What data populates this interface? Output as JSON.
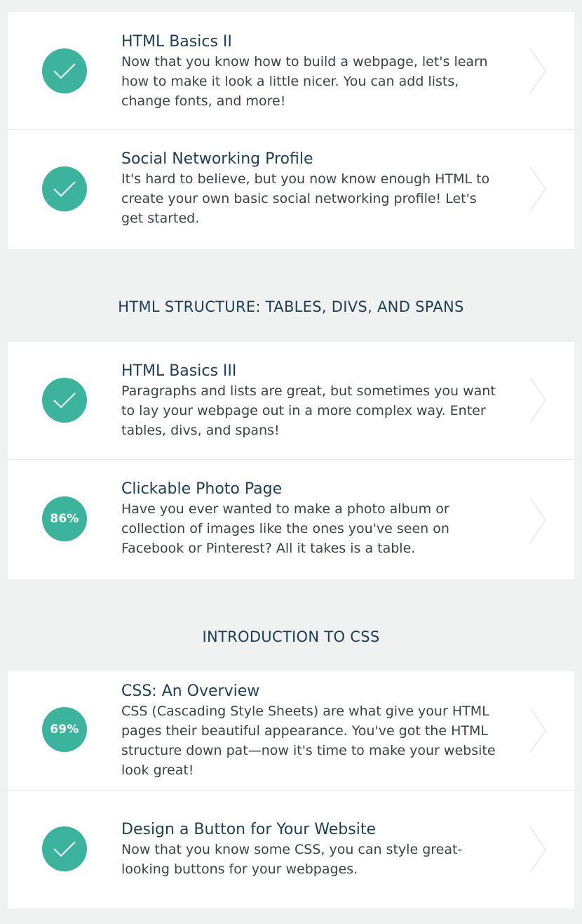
{
  "colors": {
    "accent": "#3cb39d",
    "title": "#1e3d57",
    "body_text": "#3b4248",
    "background": "#f0f2f2",
    "card": "#ffffff"
  },
  "groups": [
    {
      "lessons": [
        {
          "title": "HTML Basics II",
          "description": "Now that you know how to build a webpage, let's learn how to make it look a little nicer. You can add lists, change fonts, and more!",
          "status": "complete",
          "icon": "check-icon"
        },
        {
          "title": "Social Networking Profile",
          "description": "It's hard to believe, but you now know enough HTML to create your own basic social networking profile! Let's get started.",
          "status": "complete",
          "icon": "check-icon"
        }
      ]
    },
    {
      "section_title": "HTML STRUCTURE: TABLES, DIVS, AND SPANS",
      "lessons": [
        {
          "title": "HTML Basics III",
          "description": "Paragraphs and lists are great, but sometimes you want to lay your webpage out in a more complex way. Enter tables, divs, and spans!",
          "status": "complete",
          "icon": "check-icon"
        },
        {
          "title": "Clickable Photo Page",
          "description": "Have you ever wanted to make a photo album or collection of images like the ones you've seen on Facebook or Pinterest? All it takes is a table.",
          "status": "in-progress",
          "progress": "86%"
        }
      ]
    },
    {
      "section_title": "INTRODUCTION TO CSS",
      "lessons": [
        {
          "title": "CSS: An Overview",
          "description": "CSS (Cascading Style Sheets) are what give your HTML pages their beautiful appearance. You've got the HTML structure down pat—now it's time to make your website look great!",
          "status": "in-progress",
          "progress": "69%"
        },
        {
          "title": "Design a Button for Your Website",
          "description": "Now that you know some CSS, you can style great-looking buttons for your webpages.",
          "status": "complete",
          "icon": "check-icon"
        }
      ]
    }
  ]
}
